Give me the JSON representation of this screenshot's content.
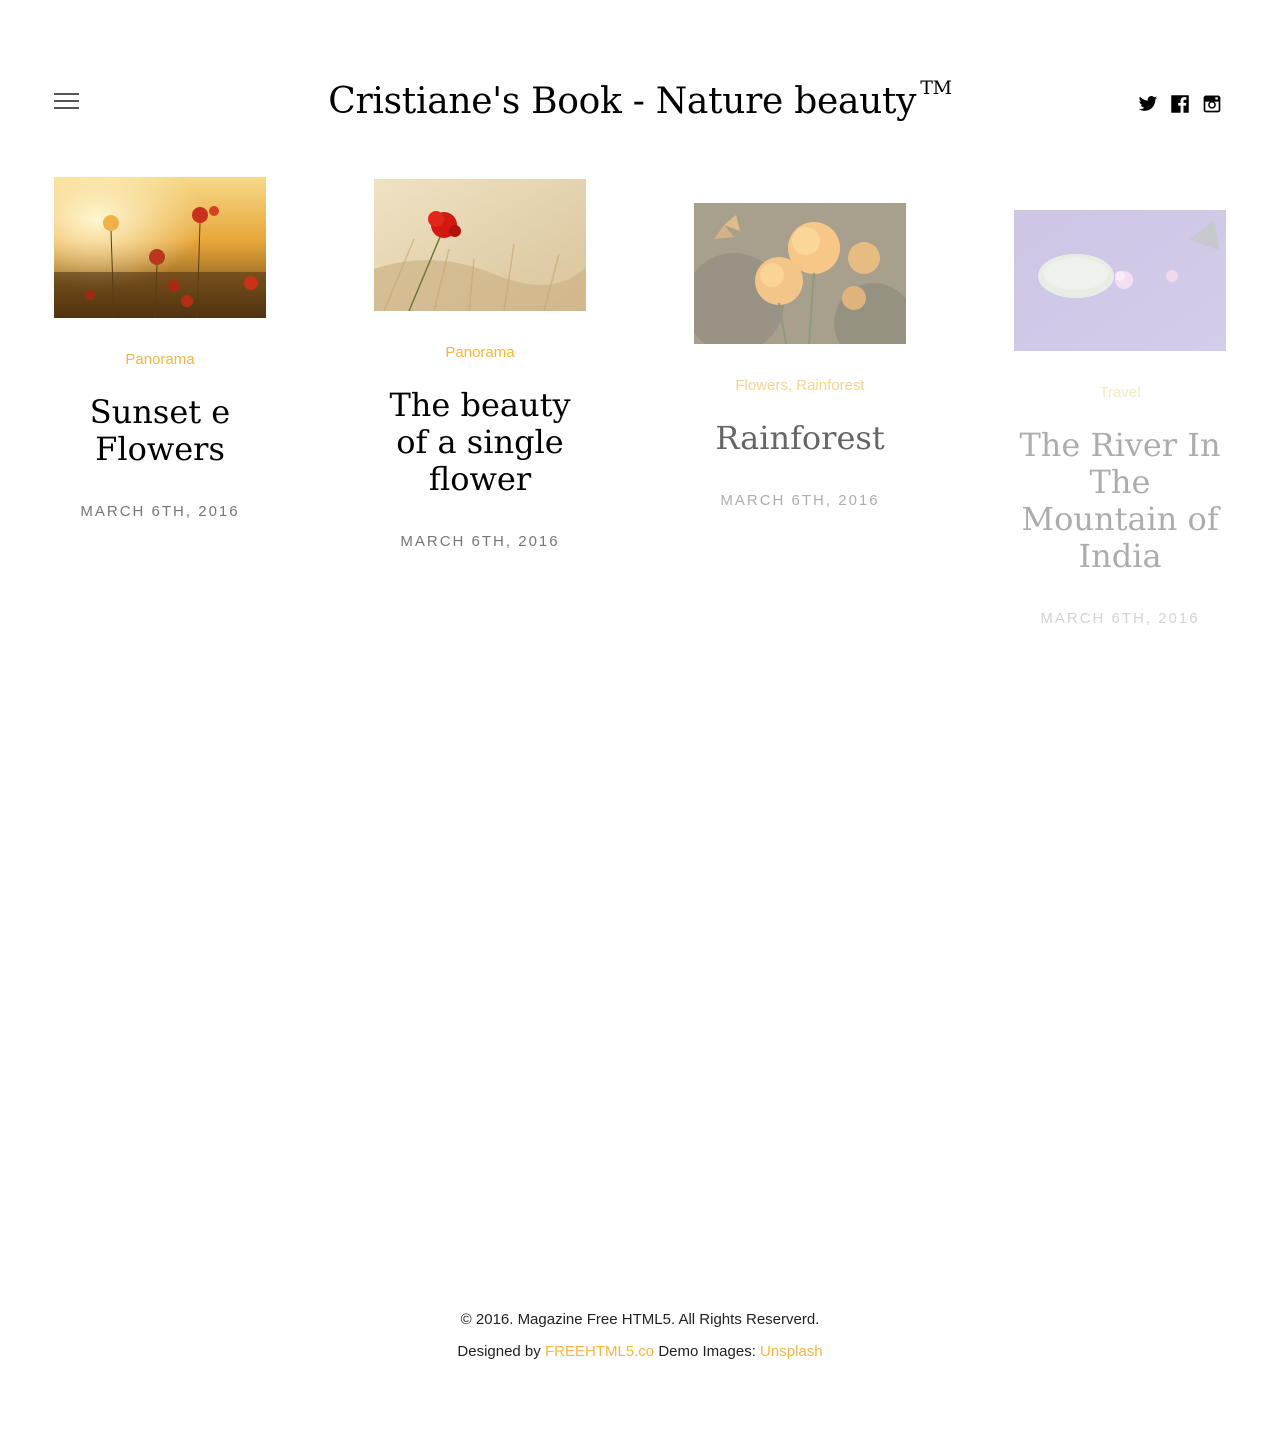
{
  "header": {
    "title": "Cristiane's Book - Nature beauty",
    "trademark": "TM",
    "menu_icon": "hamburger-icon",
    "social": [
      {
        "name": "twitter",
        "icon": "twitter-icon"
      },
      {
        "name": "facebook",
        "icon": "facebook-icon"
      },
      {
        "name": "instagram",
        "icon": "instagram-icon"
      }
    ]
  },
  "posts": [
    {
      "image": "poppy field at sunset",
      "categories": [
        "Panorama"
      ],
      "title": "Sunset e Flowers",
      "date": "March 6th, 2016"
    },
    {
      "image": "single red poppy in wheat",
      "categories": [
        "Panorama"
      ],
      "title": "The beauty of a single flower",
      "date": "March 6th, 2016"
    },
    {
      "image": "butterfly on orange flowers",
      "categories": [
        "Flowers",
        "Rainforest"
      ],
      "title": "Rainforest",
      "date": "March 6th, 2016"
    },
    {
      "image": "lotus and lily pad on water",
      "categories": [
        "Travel"
      ],
      "title": "The River In The Mountain of India",
      "date": "March 6th, 2016"
    }
  ],
  "footer": {
    "copyright": "© 2016. Magazine Free HTML5. All Rights Reserverd.",
    "designed_by_label": "Designed by",
    "designer_link": "FREEHTML5.co",
    "demo_images_label": "Demo Images:",
    "images_link": "Unsplash"
  },
  "colors": {
    "accent": "#f5b741",
    "date_gray": "#777777"
  }
}
